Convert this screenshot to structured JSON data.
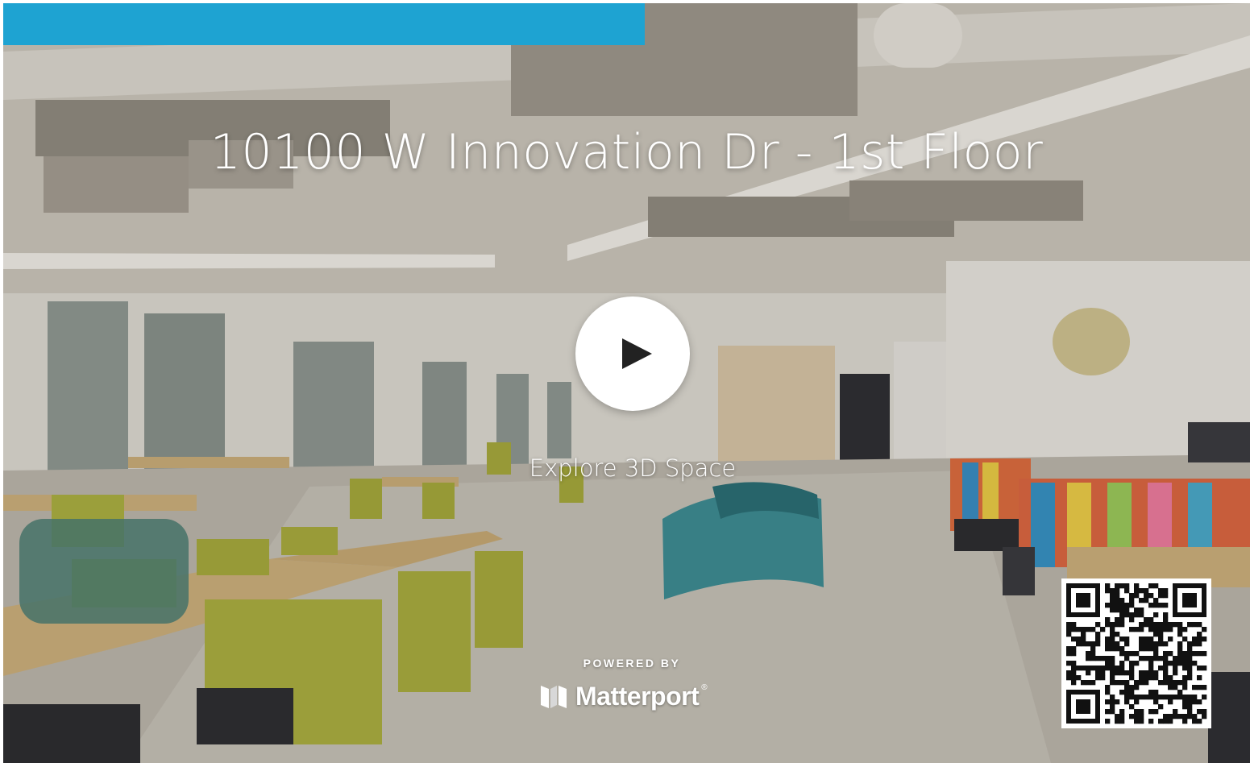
{
  "colors": {
    "accent_bar": "#1ea3d2",
    "text": "#ffffff"
  },
  "title": "10100 W Innovation Dr - 1st Floor",
  "play": {
    "icon": "play-icon"
  },
  "explore_label": "Explore 3D Space",
  "footer": {
    "powered_by": "POWERED BY",
    "brand": "Matterport",
    "brand_mark": "®",
    "logo_icon": "matterport-logo-icon"
  },
  "qr": {
    "icon": "qr-code-icon"
  }
}
